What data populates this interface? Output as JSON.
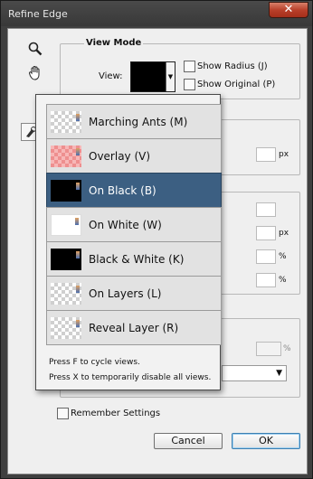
{
  "window": {
    "title": "Refine Edge",
    "close_glyph": "✕"
  },
  "view_mode": {
    "group_title": "View Mode",
    "view_label": "View:",
    "show_radius": "Show Radius (J)",
    "show_original": "Show Original (P)"
  },
  "tools": {
    "zoom": "zoom-tool-icon",
    "hand": "hand-tool-icon",
    "refine": "refine-radius-tool-icon"
  },
  "behind_units": {
    "px1": "px",
    "px2": "px",
    "pct1": "%",
    "pct2": "%",
    "pct3": "%"
  },
  "view_menu": {
    "items": [
      {
        "label": "Marching Ants (M)",
        "thumb": "checker"
      },
      {
        "label": "Overlay (V)",
        "thumb": "overlay"
      },
      {
        "label": "On Black (B)",
        "thumb": "black",
        "selected": true
      },
      {
        "label": "On White (W)",
        "thumb": "white"
      },
      {
        "label": "Black & White (K)",
        "thumb": "black"
      },
      {
        "label": "On Layers (L)",
        "thumb": "checker"
      },
      {
        "label": "Reveal Layer (R)",
        "thumb": "checker"
      }
    ],
    "hint_cycle": "Press F to cycle views.",
    "hint_disable": "Press X to temporarily disable all views."
  },
  "remember_settings": "Remember Settings",
  "buttons": {
    "cancel": "Cancel",
    "ok": "OK"
  },
  "colors": {
    "selected": "#3c5f82",
    "dialog_bg": "#efefef"
  }
}
